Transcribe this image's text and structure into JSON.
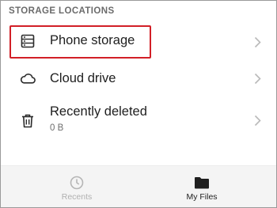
{
  "section": {
    "title": "STORAGE LOCATIONS"
  },
  "locations": [
    {
      "label": "Phone storage",
      "icon": "phone-storage-icon"
    },
    {
      "label": "Cloud drive",
      "icon": "cloud-icon"
    },
    {
      "label": "Recently deleted",
      "subtitle": "0 B",
      "icon": "trash-icon"
    }
  ],
  "bottom_nav": {
    "items": [
      {
        "label": "Recents",
        "icon": "clock-icon",
        "active": false
      },
      {
        "label": "My Files",
        "icon": "folder-icon",
        "active": true
      }
    ]
  },
  "colors": {
    "highlight": "#d21f27",
    "inactive_nav": "#b0b0b0",
    "active_nav": "#222222"
  }
}
